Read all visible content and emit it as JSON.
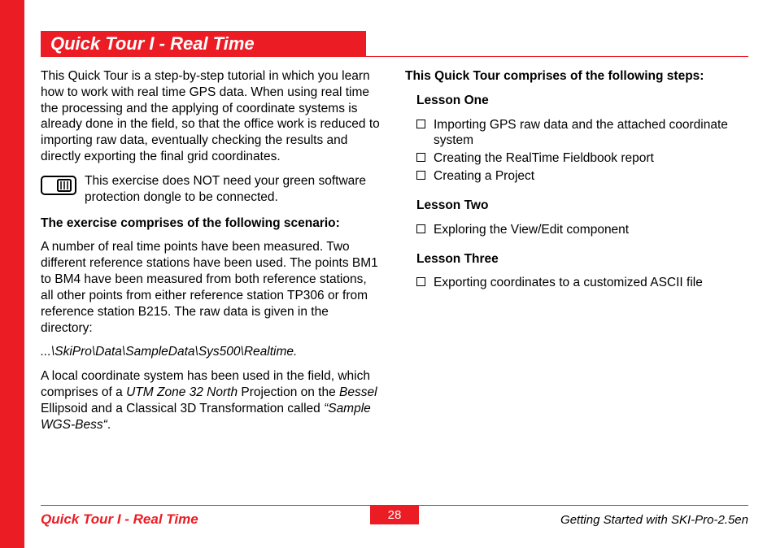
{
  "header": {
    "title": "Quick Tour I - Real Time"
  },
  "left_column": {
    "intro": "This Quick Tour is a step-by-step tutorial in which you learn how to work with real time GPS data. When using real time the processing and the applying of coordinate systems is already done in the field, so that the office work is reduced to importing raw data, eventually checking the results and directly exporting the final grid coordinates.",
    "note": "This exercise does NOT need your green software protection dongle to be connected.",
    "scenario_heading": "The exercise comprises of the following scenario:",
    "scenario_body": "A number of real time points have been measured. Two different reference stations have been used. The points BM1 to BM4 have been measured from both reference stations, all other points from either reference station TP306 or from reference station B215. The raw data is given in the directory:",
    "path": "...\\SkiPro\\Data\\SampleData\\Sys500\\Realtime.",
    "coord_body_pre": "A local coordinate system has been used in the field, which comprises of a ",
    "coord_utm": "UTM Zone 32 North",
    "coord_mid": " Projection on the ",
    "coord_bessel": "Bessel",
    "coord_post": " Ellipsoid and a Classical 3D Transformation called ",
    "coord_sample": "“Sample WGS-Bess“",
    "coord_end": "."
  },
  "right_column": {
    "steps_heading": "This Quick Tour comprises of the following steps:",
    "lessons": [
      {
        "title": "Lesson One",
        "items": [
          "Importing GPS raw data and the attached coordinate system",
          "Creating the RealTime Fieldbook report",
          "Creating a Project"
        ]
      },
      {
        "title": "Lesson Two",
        "items": [
          "Exploring the View/Edit component"
        ]
      },
      {
        "title": "Lesson Three",
        "items": [
          "Exporting coordinates to a customized ASCII file"
        ]
      }
    ]
  },
  "footer": {
    "left": "Quick Tour I - Real Time",
    "page": "28",
    "right": "Getting Started with SKI-Pro-2.5en"
  }
}
